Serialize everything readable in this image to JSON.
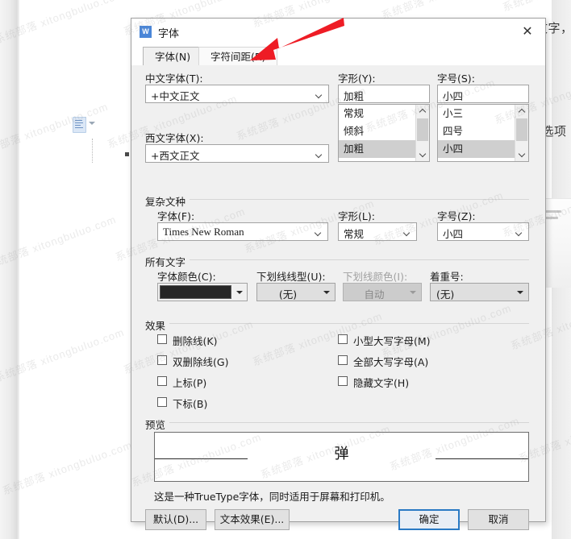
{
  "background": {
    "doc_text_top": "文字，",
    "doc_text_mid": "的选项",
    "paste_icon_name": "paste-options-icon",
    "watermark_text": "系统部落 xitongbuluo.com"
  },
  "dialog": {
    "title": "字体",
    "icon": "wps-writer-icon",
    "icon_letter": "W",
    "close_label": "✕",
    "tabs": [
      {
        "id": "font",
        "label": "字体(N)",
        "active": true
      },
      {
        "id": "char-spacing",
        "label": "字符间距(R)",
        "active": false
      }
    ],
    "chinese_font": {
      "label": "中文字体(T):",
      "value": "+中文正文"
    },
    "western_font": {
      "label": "西文字体(X):",
      "value": "+西文正文"
    },
    "font_style": {
      "label": "字形(Y):",
      "value": "加粗",
      "options": [
        "常规",
        "倾斜",
        "加粗"
      ],
      "selected": "加粗"
    },
    "font_size": {
      "label": "字号(S):",
      "value": "小四",
      "options": [
        "小三",
        "四号",
        "小四"
      ],
      "selected": "小四"
    },
    "complex_script": {
      "group_title": "复杂文种",
      "font": {
        "label": "字体(F):",
        "value": "Times New Roman"
      },
      "style": {
        "label": "字形(L):",
        "value": "常规"
      },
      "size": {
        "label": "字号(Z):",
        "value": "小四"
      }
    },
    "all_text": {
      "group_title": "所有文字",
      "font_color": {
        "label": "字体颜色(C):",
        "value": "#262626",
        "disabled": false
      },
      "underline_style": {
        "label": "下划线线型(U):",
        "value": "(无)",
        "disabled": false
      },
      "underline_color": {
        "label": "下划线颜色(I):",
        "value": "自动",
        "disabled": true
      },
      "emphasis_mark": {
        "label": "着重号:",
        "value": "(无)",
        "disabled": false
      }
    },
    "effects": {
      "group_title": "效果",
      "left_column": [
        {
          "label": "删除线(K)",
          "checked": false
        },
        {
          "label": "双删除线(G)",
          "checked": false
        },
        {
          "label": "上标(P)",
          "checked": false
        },
        {
          "label": "下标(B)",
          "checked": false
        }
      ],
      "right_column": [
        {
          "label": "小型大写字母(M)",
          "checked": false
        },
        {
          "label": "全部大写字母(A)",
          "checked": false
        },
        {
          "label": "隐藏文字(H)",
          "checked": false
        }
      ]
    },
    "preview": {
      "group_title": "预览",
      "sample_text": "弹",
      "note": "这是一种TrueType字体，同时适用于屏幕和打印机。"
    },
    "buttons": {
      "default": "默认(D)...",
      "text_effects": "文本效果(E)...",
      "ok": "确定",
      "cancel": "取消"
    }
  },
  "annotation": {
    "arrow_color": "#ee1c25",
    "points_at": "字符间距(R)"
  }
}
